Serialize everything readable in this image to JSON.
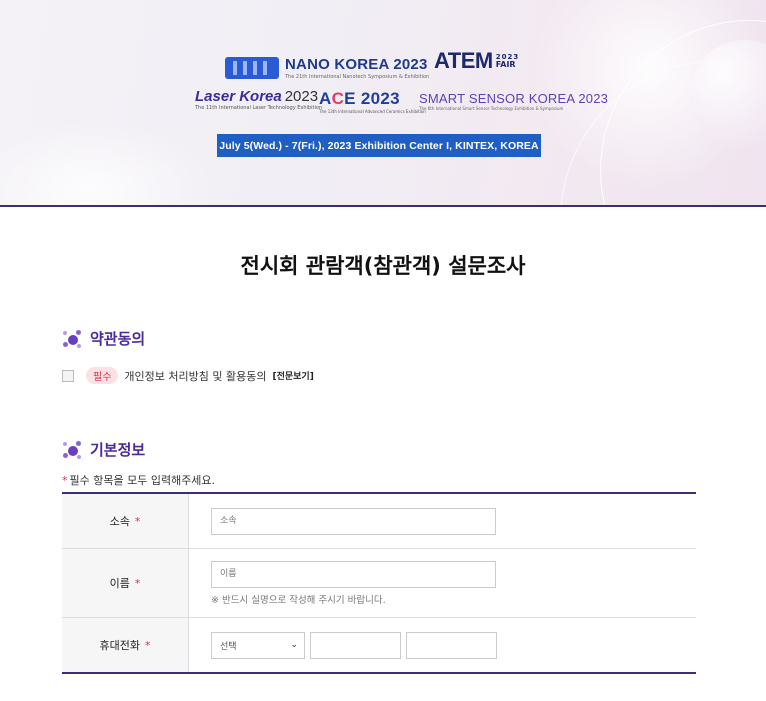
{
  "banner": {
    "nano": {
      "name": "NANO KOREA 2023",
      "sub": "The 21th International Nanotech Symposium & Exhibition"
    },
    "atem": {
      "name": "ATEM",
      "year": "2023",
      "fair": "FAIR"
    },
    "laser": {
      "name": "Laser Korea",
      "year": "2023",
      "sub": "The 11th International Laser Technology Exhibition"
    },
    "ace": {
      "name_a": "A",
      "name_c": "C",
      "name_e": "E 2023",
      "sub": "The 13th International Advanced Ceramics Exhibition"
    },
    "sensor": {
      "name": "SMART SENSOR KOREA 2023",
      "sub": "The 6th International Smart Sensor Technology Exhibition & Symposium"
    },
    "date": "July 5(Wed.) - 7(Fri.), 2023  Exhibition Center I, KINTEX, KOREA"
  },
  "page_title": "전시회 관람객(참관객) 설문조사",
  "terms_section": {
    "heading": "약관동의",
    "required_badge": "필수",
    "agree_text": "개인정보 처리방침 및 활용동의",
    "view_link": "[전문보기]"
  },
  "basic_section": {
    "heading": "기본정보",
    "note_star": "*",
    "note": "필수 항목을 모두 입력해주세요."
  },
  "form": {
    "affiliation": {
      "label": "소속",
      "star": "*",
      "placeholder": "소속"
    },
    "name": {
      "label": "이름",
      "star": "*",
      "placeholder": "이름",
      "hint": "※ 반드시 실명으로 작성해 주시기 바랍니다."
    },
    "phone": {
      "label": "휴대전화",
      "star": "*",
      "select_value": "선택"
    }
  },
  "colors": {
    "accent": "#3b2d7a",
    "required": "#d0344a",
    "date_bar": "#1f5fc4"
  }
}
